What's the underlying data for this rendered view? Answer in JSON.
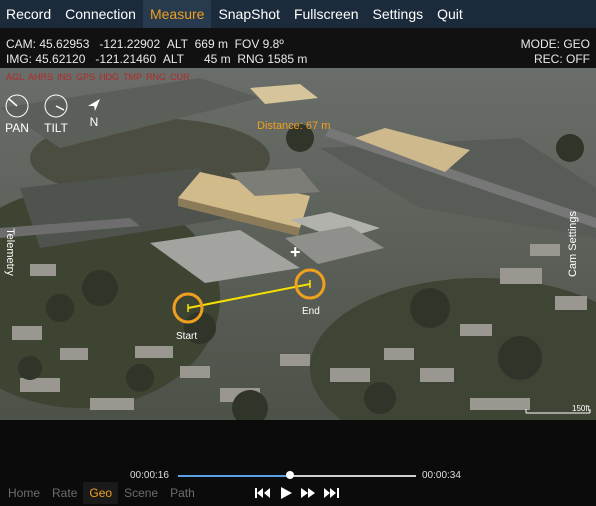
{
  "menu": [
    "Record",
    "Connection",
    "Measure",
    "SnapShot",
    "Fullscreen",
    "Settings",
    "Quit"
  ],
  "menu_active": "Measure",
  "info": {
    "cam_label": "CAM:",
    "cam_lat": "45.62953",
    "cam_lon": "-121.22902",
    "cam_alt_label": "ALT",
    "cam_alt": "669 m",
    "fov_label": "FOV",
    "fov": "9.8º",
    "img_label": "IMG:",
    "img_lat": "45.62120",
    "img_lon": "-121.21460",
    "img_alt_label": "ALT",
    "img_alt": "45 m",
    "rng_label": "RNG",
    "rng": "1585 m",
    "mode": "MODE: GEO",
    "rec": "REC:   OFF"
  },
  "alerts": [
    "AGL",
    "AHRS",
    "INS",
    "GPS",
    "HDG",
    "TMP",
    "RNG",
    "CUR"
  ],
  "gauges": {
    "pan": "PAN",
    "tilt": "TILT",
    "north": "N"
  },
  "side": {
    "left": "Telemetry",
    "right": "Cam Settings"
  },
  "measure": {
    "distance": "Distance: 67 m",
    "start": "Start",
    "end": "End"
  },
  "scale_label": "150ft",
  "playback": {
    "current": "00:00:16",
    "total": "00:00:34",
    "progress": 0.47
  },
  "tabs": [
    "Home",
    "Rate",
    "Geo",
    "Scene",
    "Path"
  ],
  "tab_active": "Geo",
  "colors": {
    "menubar": "#1c2b3b",
    "accent": "#f0a020",
    "alert": "#b32a2a",
    "measure_line": "#f5e000"
  }
}
